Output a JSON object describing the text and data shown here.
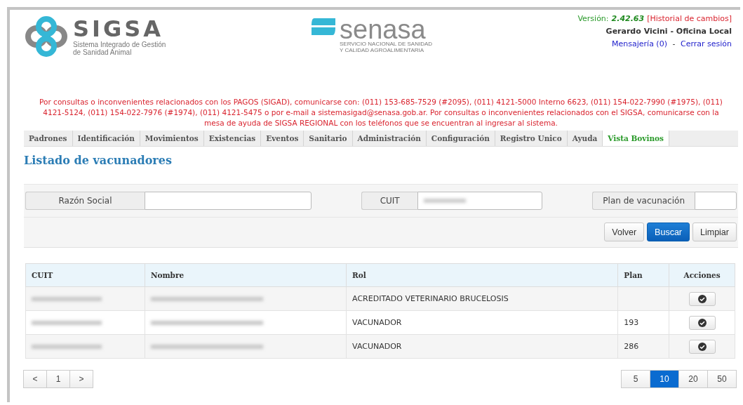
{
  "header": {
    "sigsa_logo": {
      "name": "SIGSA",
      "subtitle_1": "Sistema Integrado de Gestión",
      "subtitle_2": "de Sanidad Animal"
    },
    "senasa_logo": {
      "name": "senasa",
      "subtitle_1": "SERVICIO NACIONAL DE SANIDAD",
      "subtitle_2": "Y CALIDAD AGROALIMENTARIA"
    },
    "version_label": "Versión:",
    "version": "2.42.63",
    "changelog_link": "[Historial de cambios]",
    "user": "Gerardo Vicini - Oficina Local",
    "messages_link": "Mensajería (0)",
    "separator": "-",
    "logout_link": "Cerrar sesión"
  },
  "notice": "Por consultas o inconvenientes relacionados con los PAGOS (SIGAD), comunicarse con: (011) 153-685-7529 (#2095), (011) 4121-5000 Interno 6623, (011) 154-022-7990 (#1975), (011) 4121-5124, (011) 154-022-7976 (#1974), (011) 4121-5475 o por e-mail a sistemasigad@senasa.gob.ar. Por consultas o inconvenientes relacionados con el SIGSA, comunicarse con la mesa de ayuda de SIGSA REGIONAL con los teléfonos que se encuentran al ingresar al sistema.",
  "menu": [
    {
      "label": "Padrones",
      "highlighted": false
    },
    {
      "label": "Identificación",
      "highlighted": false
    },
    {
      "label": "Movimientos",
      "highlighted": false
    },
    {
      "label": "Existencias",
      "highlighted": false
    },
    {
      "label": "Eventos",
      "highlighted": false
    },
    {
      "label": "Sanitario",
      "highlighted": false
    },
    {
      "label": "Administración",
      "highlighted": false
    },
    {
      "label": "Configuración",
      "highlighted": false
    },
    {
      "label": "Registro Unico",
      "highlighted": false
    },
    {
      "label": "Ayuda",
      "highlighted": false
    },
    {
      "label": "Vista Bovinos",
      "highlighted": true
    }
  ],
  "page_title": "Listado de vacunadores",
  "filters": [
    {
      "label": "Razón Social",
      "redacted": false
    },
    {
      "label": "CUIT",
      "redacted": true
    },
    {
      "label": "Plan de vacunación",
      "redacted": false
    }
  ],
  "buttons": [
    {
      "label": "Volver",
      "primary": false
    },
    {
      "label": "Buscar",
      "primary": true
    },
    {
      "label": "Limpiar",
      "primary": false
    }
  ],
  "table": {
    "columns": [
      "CUIT",
      "Nombre",
      "Rol",
      "Plan",
      "Acciones"
    ],
    "rows": [
      {
        "rol": "ACREDITADO VETERINARIO BRUCELOSIS"
      },
      {
        "rol": "VACUNADOR",
        "plan": "193"
      },
      {
        "rol": "VACUNADOR",
        "plan": "286"
      }
    ]
  },
  "pager": {
    "prev": "<",
    "pages": [
      {
        "label": "1",
        "selected": false
      }
    ],
    "next": ">"
  },
  "page_sizes": [
    {
      "label": "5",
      "selected": false
    },
    {
      "label": "10",
      "selected": true
    },
    {
      "label": "20",
      "selected": false
    },
    {
      "label": "50",
      "selected": false
    }
  ]
}
